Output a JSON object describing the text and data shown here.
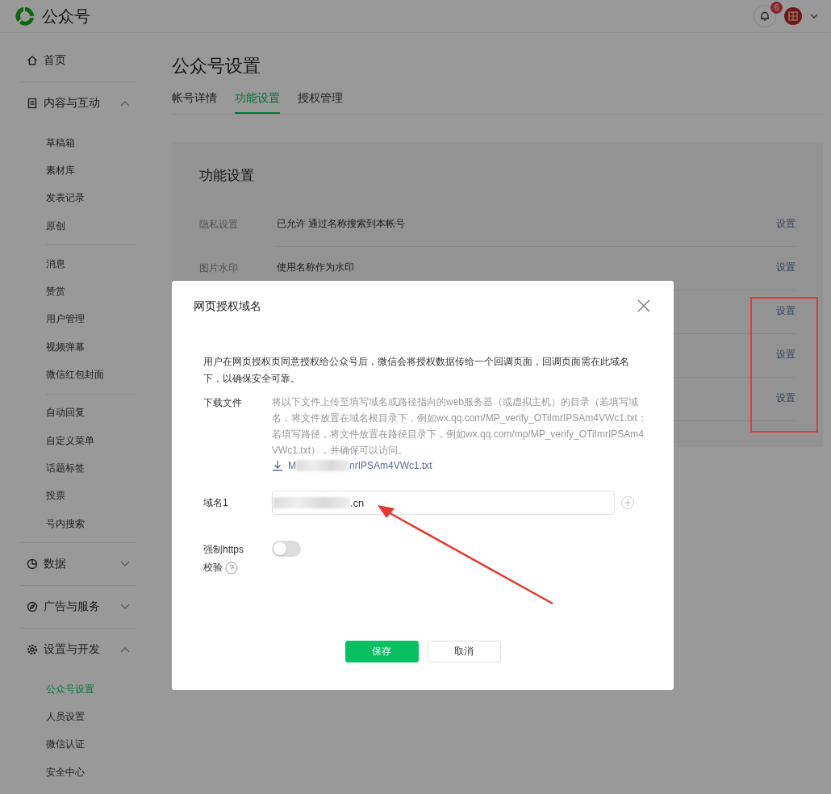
{
  "app": {
    "name": "公众号",
    "notification_count": "6"
  },
  "sidebar": {
    "items": [
      {
        "kind": "link",
        "label": "首页"
      },
      {
        "kind": "group",
        "label": "内容与互动",
        "expanded": true,
        "sections": [
          [
            {
              "label": "草稿箱",
              "selected": false
            },
            {
              "label": "素材库",
              "selected": false
            },
            {
              "label": "发表记录",
              "selected": false
            },
            {
              "label": "原创",
              "selected": false
            }
          ],
          [
            {
              "label": "消息",
              "selected": false
            },
            {
              "label": "赞赏",
              "selected": false
            },
            {
              "label": "用户管理",
              "selected": false
            },
            {
              "label": "视频弹幕",
              "selected": false
            },
            {
              "label": "微信红包封面",
              "selected": false
            }
          ],
          [
            {
              "label": "自动回复",
              "selected": false
            },
            {
              "label": "自定义菜单",
              "selected": false
            },
            {
              "label": "话题标签",
              "selected": false
            },
            {
              "label": "投票",
              "selected": false
            },
            {
              "label": "号内搜索",
              "selected": false
            }
          ]
        ]
      },
      {
        "kind": "group",
        "label": "数据",
        "expanded": false
      },
      {
        "kind": "group",
        "label": "广告与服务",
        "expanded": false
      },
      {
        "kind": "group",
        "label": "设置与开发",
        "expanded": true,
        "sections": [
          [
            {
              "label": "公众号设置",
              "selected": true
            },
            {
              "label": "人员设置",
              "selected": false
            },
            {
              "label": "微信认证",
              "selected": false
            },
            {
              "label": "安全中心",
              "selected": false
            }
          ]
        ]
      }
    ]
  },
  "page": {
    "title": "公众号设置",
    "tabs": [
      {
        "label": "帐号详情",
        "selected": false
      },
      {
        "label": "功能设置",
        "selected": true
      },
      {
        "label": "授权管理",
        "selected": false
      }
    ]
  },
  "card": {
    "title": "功能设置",
    "rows": [
      {
        "label": "隐私设置",
        "value": "已允许 通过名称搜索到本帐号",
        "action": "设置"
      },
      {
        "label": "图片水印",
        "value": "使用名称作为水印",
        "action": "设置"
      },
      {
        "action": "设置"
      },
      {
        "action": "设置"
      },
      {
        "action": "设置"
      }
    ]
  },
  "modal": {
    "title": "网页授权域名",
    "description": "用户在网页授权页同意授权给公众号后，微信会将授权数据传给一个回调页面，回调页面需在此域名下，以确保安全可靠。",
    "download": {
      "label": "下载文件",
      "text": "将以下文件上传至填写域名或路径指向的web服务器（或虚拟主机）的目录（若填写域名，将文件放置在域名根目录下，例如wx.qq.com/MP_verify_OTiImrIPSAm4VWc1.txt；若填写路径，将文件放置在路径目录下，例如wx.qq.com/mp/MP_verify_OTiImrIPSAm4VWc1.txt），并确保可以访问。",
      "file_start": "M",
      "file_end": "nrIPSAm4VWc1.txt"
    },
    "domain": {
      "label": "域名1",
      "value": ".cn"
    },
    "https": {
      "label": "强制https校验",
      "on": false
    },
    "buttons": [
      {
        "kind": "primary",
        "label": "保存"
      },
      {
        "kind": "default",
        "label": "取消"
      }
    ]
  }
}
